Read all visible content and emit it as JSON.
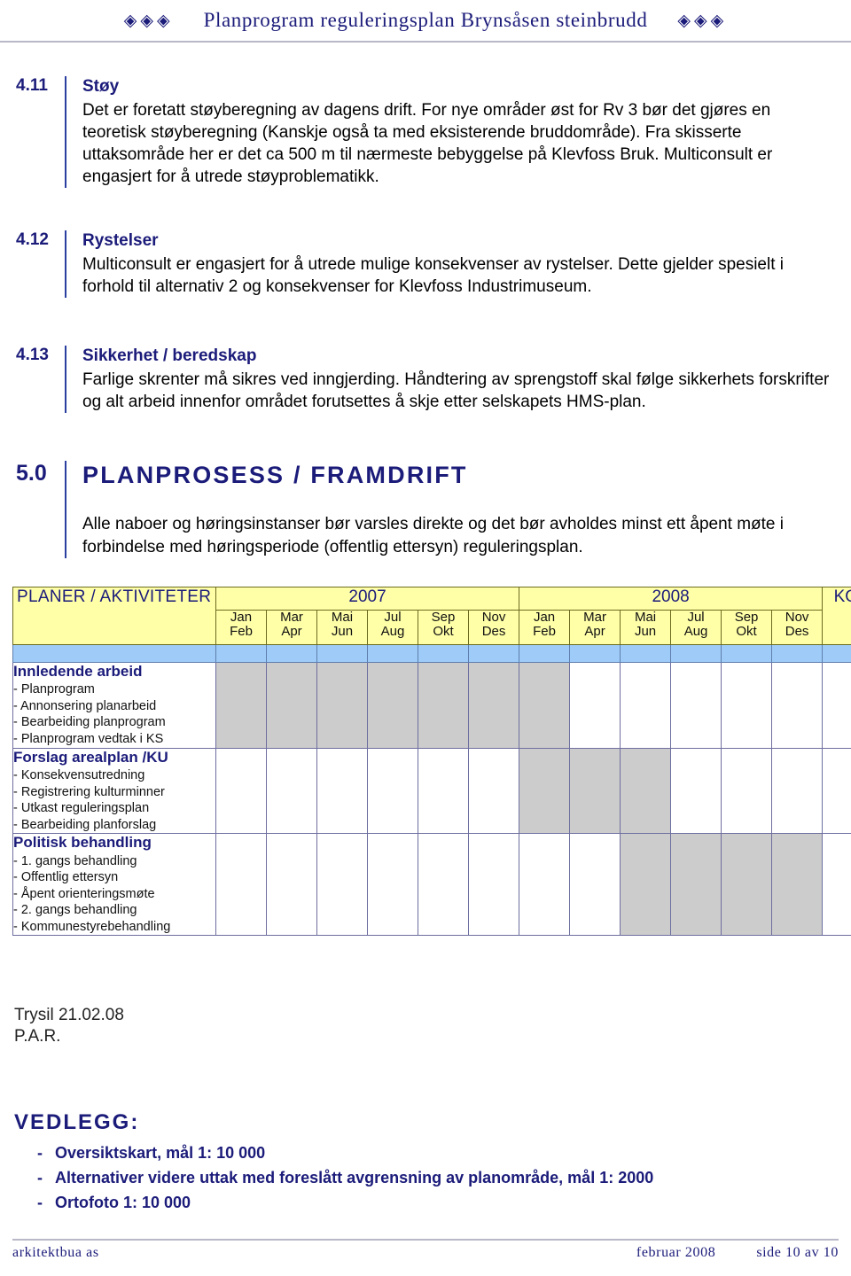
{
  "header": {
    "left_ornament": "◈◈◈",
    "title": "Planprogram reguleringsplan Brynsåsen steinbrudd",
    "right_ornament": "◈◈◈"
  },
  "sections": [
    {
      "number": "4.11",
      "heading": "Støy",
      "body": "Det er foretatt støyberegning av dagens drift. For nye områder øst for Rv 3 bør det gjøres en teoretisk støyberegning (Kanskje også ta med eksisterende bruddområde). Fra skisserte uttaksområde her er det ca 500 m til nærmeste bebyggelse på Klevfoss Bruk. Multiconsult er engasjert for å utrede støyproblematikk."
    },
    {
      "number": "4.12",
      "heading": "Rystelser",
      "body": "Multiconsult er engasjert for å utrede mulige konsekvenser av rystelser. Dette gjelder spesielt i forhold til alternativ 2 og konsekvenser for Klevfoss Industrimuseum."
    },
    {
      "number": "4.13",
      "heading": "Sikkerhet / beredskap",
      "body": "Farlige skrenter må sikres ved inngjerding. Håndtering av sprengstoff skal følge sikkerhets forskrifter og alt arbeid innenfor området forutsettes å skje etter selskapets HMS-plan."
    },
    {
      "number": "5.0",
      "heading": "PLANPROSESS / FRAMDRIFT",
      "body": "Alle naboer og høringsinstanser bør varsles direkte og det bør avholdes minst ett åpent møte i forbindelse med høringsperiode (offentlig ettersyn) reguleringsplan."
    }
  ],
  "gantt": {
    "col_activity_header": "PLANER / AKTIVITETER",
    "col_comment_header": "KOMMENTAR",
    "years": [
      "2007",
      "2008"
    ],
    "months": [
      {
        "top": "Jan",
        "bottom": "Feb"
      },
      {
        "top": "Mar",
        "bottom": "Apr"
      },
      {
        "top": "Mai",
        "bottom": "Jun"
      },
      {
        "top": "Jul",
        "bottom": "Aug"
      },
      {
        "top": "Sep",
        "bottom": "Okt"
      },
      {
        "top": "Nov",
        "bottom": "Des"
      },
      {
        "top": "Jan",
        "bottom": "Feb"
      },
      {
        "top": "Mar",
        "bottom": "Apr"
      },
      {
        "top": "Mai",
        "bottom": "Jun"
      },
      {
        "top": "Jul",
        "bottom": "Aug"
      },
      {
        "top": "Sep",
        "bottom": "Okt"
      },
      {
        "top": "Nov",
        "bottom": "Des"
      }
    ],
    "rows": [
      {
        "title": "Innledende arbeid",
        "items": [
          "- Planprogram",
          "- Annonsering planarbeid",
          "- Bearbeiding planprogram",
          "- Planprogram vedtak i KS"
        ],
        "filled": [
          true,
          true,
          true,
          true,
          true,
          true,
          true,
          false,
          false,
          false,
          false,
          false
        ],
        "comment": ""
      },
      {
        "title": "Forslag arealplan /KU",
        "items": [
          "- Konsekvensutredning",
          "- Registrering kulturminner",
          "- Utkast reguleringsplan",
          "- Bearbeiding planforslag"
        ],
        "filled": [
          false,
          false,
          false,
          false,
          false,
          false,
          true,
          true,
          true,
          false,
          false,
          false
        ],
        "comment": ""
      },
      {
        "title": "Politisk behandling",
        "items": [
          "- 1. gangs behandling",
          "- Offentlig ettersyn",
          "- Åpent orienteringsmøte",
          "- 2. gangs behandling",
          "- Kommunestyrebehandling"
        ],
        "filled": [
          false,
          false,
          false,
          false,
          false,
          false,
          false,
          false,
          true,
          true,
          true,
          true
        ],
        "comment": ""
      }
    ]
  },
  "signoff": {
    "place_date": "Trysil 21.02.08",
    "initials": "P.A.R."
  },
  "vedlegg": {
    "title": "VEDLEGG:",
    "items": [
      {
        "dash": "-",
        "text": "Oversiktskart, mål 1: 10 000"
      },
      {
        "dash": "-",
        "text": "Alternativer videre uttak med foreslått avgrensning av planområde, mål 1: 2000"
      },
      {
        "dash": "-",
        "text": "Ortofoto 1: 10 000"
      }
    ]
  },
  "footer": {
    "company": "arkitektbua as",
    "date": "februar 2008",
    "page": "side 10 av 10"
  },
  "colors": {
    "heading_blue": "#1b1b7a",
    "table_header_yellow": "#ffffa8",
    "band_blue": "#9ecbf7",
    "cell_fill_gray": "#cccccc"
  }
}
